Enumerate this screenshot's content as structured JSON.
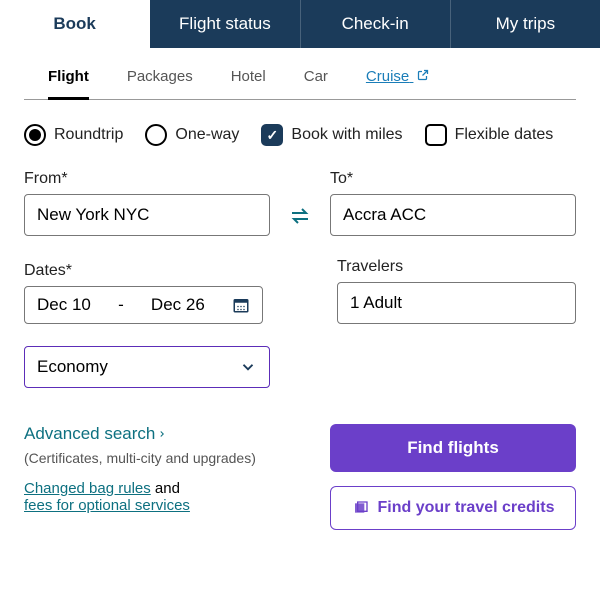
{
  "mainTabs": {
    "book": "Book",
    "flightStatus": "Flight status",
    "checkIn": "Check-in",
    "myTrips": "My trips"
  },
  "subTabs": {
    "flight": "Flight",
    "packages": "Packages",
    "hotel": "Hotel",
    "car": "Car",
    "cruise": "Cruise"
  },
  "options": {
    "roundtrip": "Roundtrip",
    "oneWay": "One-way",
    "bookWithMiles": "Book with miles",
    "flexibleDates": "Flexible dates"
  },
  "form": {
    "fromLabel": "From*",
    "fromValue": "New York NYC",
    "toLabel": "To*",
    "toValue": "Accra ACC",
    "datesLabel": "Dates*",
    "dateStart": "Dec 10",
    "dateSep": "-",
    "dateEnd": "Dec 26",
    "travelersLabel": "Travelers",
    "travelersValue": "1 Adult",
    "cabinValue": "Economy"
  },
  "links": {
    "advancedSearch": "Advanced search",
    "advancedNote": "(Certificates, multi-city and upgrades)",
    "changedBag": "Changed bag rules",
    "and": " and ",
    "fees": "fees for optional services"
  },
  "buttons": {
    "findFlights": "Find flights",
    "findCredits": "Find your travel credits"
  }
}
